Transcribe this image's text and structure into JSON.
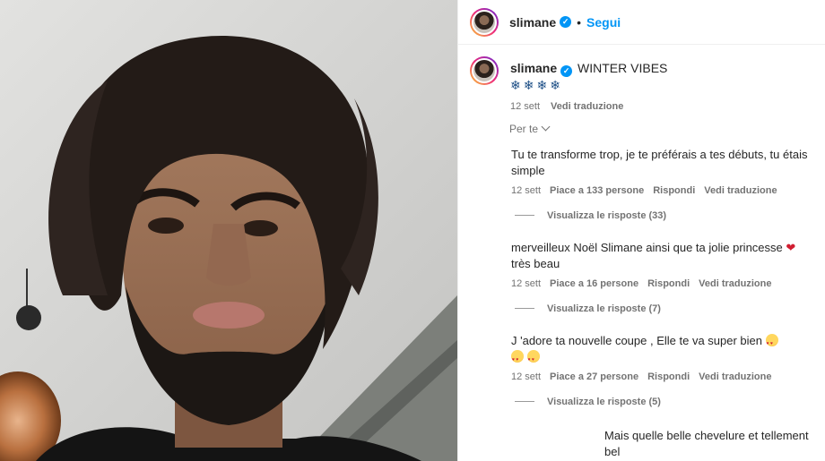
{
  "post": {
    "username": "slimane",
    "separator": "•",
    "follow_label": "Segui",
    "caption_text": "WINTER VIBES",
    "caption_emojis": "❄❄❄❄",
    "caption_date": "12 sett",
    "caption_translate": "Vedi traduzione"
  },
  "comments_section": {
    "sort_label": "Per te",
    "comments": [
      {
        "text": "Tu te transforme trop, je te préférais a tes débuts, tu étais simple",
        "date": "12 sett",
        "likes": "Piace a 133 persone",
        "reply": "Rispondi",
        "translate": "Vedi traduzione",
        "view_replies": "Visualizza le risposte (33)"
      },
      {
        "text_before": "merveilleux Noël Slimane ainsi que ta jolie princesse ",
        "heart": "❤",
        "text_after": "très beau",
        "date": "12 sett",
        "likes": "Piace a 16 persone",
        "reply": "Rispondi",
        "translate": "Vedi traduzione",
        "view_replies": "Visualizza le risposte (7)"
      },
      {
        "text": "J 'adore ta nouvelle coupe , Elle te va super bien",
        "date": "12 sett",
        "likes": "Piace a 27 persone",
        "reply": "Rispondi",
        "translate": "Vedi traduzione",
        "view_replies": "Visualizza le risposte (5)"
      },
      {
        "text": "Mais quelle belle chevelure et tellement bel"
      }
    ]
  },
  "colors": {
    "accent": "#0095f6",
    "text": "#262626",
    "muted": "#737373",
    "heart": "#d11e31"
  }
}
